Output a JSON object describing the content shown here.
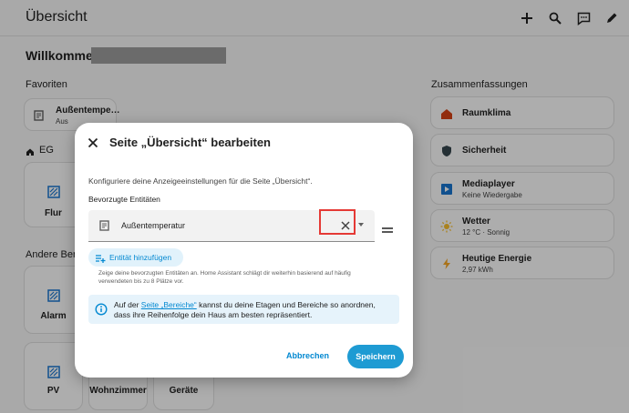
{
  "topbar": {
    "title": "Übersicht",
    "icons": [
      "plus-icon",
      "search-icon",
      "chat-icon",
      "pencil-icon"
    ]
  },
  "dashboard": {
    "welcome": "Willkommen",
    "favoriten_heading": "Favoriten",
    "favorite": {
      "name": "Außentempe…",
      "state": "Aus"
    },
    "eg_heading": "EG",
    "andere_heading": "Andere Bere",
    "zusammenfassungen_heading": "Zusammenfassungen",
    "area_tiles": [
      "Flur",
      "Alarm",
      "PV",
      "Wohnzimmer",
      "Geräte"
    ],
    "summaries": [
      {
        "name": "Raumklima",
        "state": ""
      },
      {
        "name": "Sicherheit",
        "state": ""
      },
      {
        "name": "Mediaplayer",
        "state": "Keine Wiedergabe"
      },
      {
        "name": "Wetter",
        "state": "12 °C · Sonnig"
      },
      {
        "name": "Heutige Energie",
        "state": "2,97 kWh"
      }
    ]
  },
  "dialog": {
    "title": "Seite „Übersicht“ bearbeiten",
    "description": "Konfiguriere deine Anzeigeeinstellungen für die Seite „Übersicht“.",
    "field_label": "Bevorzugte Entitäten",
    "entity_value": "Außentemperatur",
    "add_entity_label": "Entität hinzufügen",
    "help_text": "Zeige deine bevorzugten Entitäten an. Home Assistant schlägt dir weiterhin basierend auf häufig verwendeten bis zu 8 Plätze vor.",
    "info_prefix": "Auf der ",
    "info_link": "Seite „Bereiche“",
    "info_suffix": " kannst du deine Etagen und Bereiche so anordnen, dass ihre Reihenfolge dein Haus am besten repräsentiert.",
    "cancel_label": "Abbrechen",
    "save_label": "Speichern"
  },
  "colors": {
    "accent": "#0288d1",
    "save_button": "#1e9bd3",
    "highlight_box": "#e53935"
  }
}
